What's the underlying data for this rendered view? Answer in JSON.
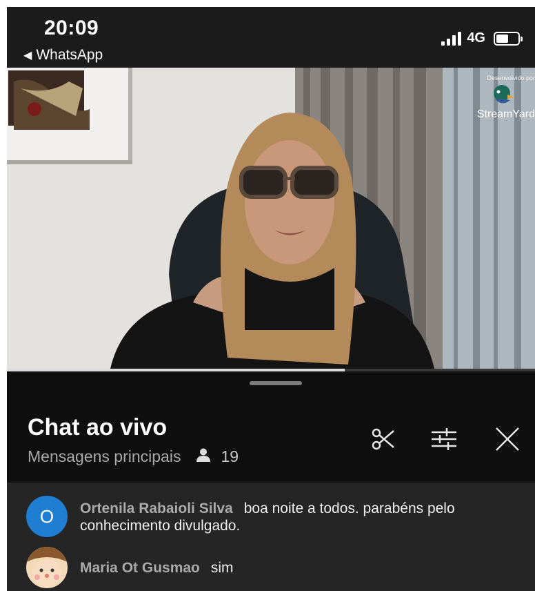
{
  "status_bar": {
    "time": "20:09",
    "back_app": "WhatsApp",
    "network": "4G",
    "battery_level": 0.55
  },
  "video": {
    "watermark_line1": "Desenvolvido por",
    "watermark_brand": "StreamYard",
    "progress": 0.64
  },
  "chat": {
    "title": "Chat ao vivo",
    "subtitle": "Mensagens principais",
    "viewer_count": "19",
    "messages": [
      {
        "avatar_letter": "O",
        "avatar_color": "#1f7ed1",
        "author": "Ortenila Rabaioli Silva",
        "text": "boa noite a todos. parabéns pelo conhecimento divulgado."
      },
      {
        "author": "Maria Ot Gusmao",
        "text": "sim"
      }
    ]
  }
}
